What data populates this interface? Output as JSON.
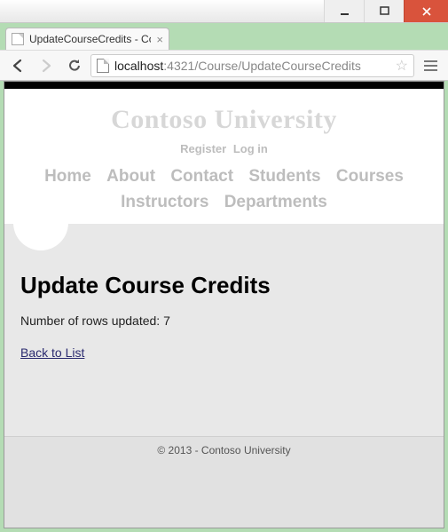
{
  "window": {
    "tab_title": "UpdateCourseCredits - Co"
  },
  "address": {
    "host": "localhost",
    "port": ":4321",
    "path": "/Course/UpdateCourseCredits"
  },
  "site": {
    "title": "Contoso University",
    "auth": {
      "register": "Register",
      "login": "Log in"
    },
    "nav": {
      "home": "Home",
      "about": "About",
      "contact": "Contact",
      "students": "Students",
      "courses": "Courses",
      "instructors": "Instructors",
      "departments": "Departments"
    }
  },
  "page": {
    "title": "Update Course Credits",
    "message_prefix": "Number of rows updated: ",
    "rows_updated": "7",
    "back_link": "Back to List"
  },
  "footer": {
    "text": "© 2013 - Contoso University"
  }
}
